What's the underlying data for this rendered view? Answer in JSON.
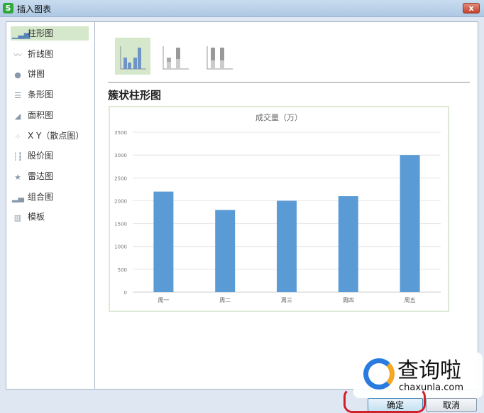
{
  "window": {
    "title": "插入图表",
    "app_icon": "S",
    "close": "x"
  },
  "sidebar": {
    "items": [
      {
        "label": "柱形图",
        "icon": "column-chart-icon"
      },
      {
        "label": "折线图",
        "icon": "line-chart-icon"
      },
      {
        "label": "饼图",
        "icon": "pie-chart-icon"
      },
      {
        "label": "条形图",
        "icon": "bar-chart-icon"
      },
      {
        "label": "面积图",
        "icon": "area-chart-icon"
      },
      {
        "label": "X Y（散点图）",
        "icon": "scatter-chart-icon"
      },
      {
        "label": "股价图",
        "icon": "stock-chart-icon"
      },
      {
        "label": "雷达图",
        "icon": "radar-chart-icon"
      },
      {
        "label": "组合图",
        "icon": "combo-chart-icon"
      },
      {
        "label": "模板",
        "icon": "template-icon"
      }
    ],
    "selected": 0
  },
  "main": {
    "subtype_title": "簇状柱形图",
    "subtypes": [
      "clustered",
      "stacked",
      "percent-stacked"
    ],
    "selected_subtype": 0
  },
  "buttons": {
    "ok": "确定",
    "cancel": "取消"
  },
  "watermark": {
    "text": "查询啦",
    "url": "chaxunla.com"
  },
  "colors": {
    "bar": "#5b9bd5",
    "selected": "#d6e8cc"
  },
  "chart_data": {
    "type": "bar",
    "title": "成交量（万）",
    "categories": [
      "周一",
      "周二",
      "周三",
      "周四",
      "周五"
    ],
    "values": [
      2200,
      1800,
      2000,
      2100,
      3000
    ],
    "ylim": [
      0,
      3500
    ],
    "yticks": [
      "0",
      "500",
      "1000",
      "1500",
      "2000",
      "2500",
      "3000",
      "3500"
    ],
    "grid": true,
    "xlabel": "",
    "ylabel": ""
  }
}
